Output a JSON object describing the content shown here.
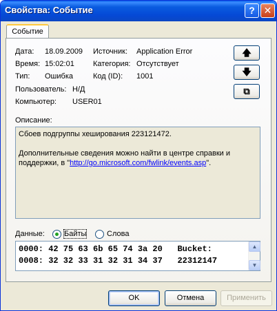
{
  "window": {
    "title": "Свойства: Событие",
    "help_glyph": "?",
    "close_glyph": "✕"
  },
  "tabs": [
    {
      "label": "Событие"
    }
  ],
  "fields": {
    "date_label": "Дата:",
    "date_value": "18.09.2009",
    "source_label": "Источник:",
    "source_value": "Application Error",
    "time_label": "Время:",
    "time_value": "15:02:01",
    "category_label": "Категория:",
    "category_value": "Отсутствует",
    "type_label": "Тип:",
    "type_value": "Ошибка",
    "eventid_label": "Код (ID):",
    "eventid_value": "1001",
    "user_label": "Пользователь:",
    "user_value": "Н/Д",
    "computer_label": "Компьютер:",
    "computer_value": "USER01"
  },
  "side_buttons": {
    "up_glyph": "🡅",
    "down_glyph": "🡇",
    "copy_glyph": "⧉"
  },
  "description": {
    "label": "Описание:",
    "line1": "Сбоев подгруппы хеширования 223121472.",
    "line2_pre": "Дополнительные сведения можно найти в центре справки и поддержки, в \"",
    "link": "http://go.microsoft.com/fwlink/events.asp",
    "line2_post": "\"."
  },
  "data_section": {
    "label": "Данные:",
    "bytes_label": "Байты",
    "words_label": "Слова",
    "selected": "bytes",
    "rows": [
      "0000: 42 75 63 6b 65 74 3a 20   Bucket: ",
      "0008: 32 32 33 31 32 31 34 37   22312147"
    ]
  },
  "footer": {
    "ok_label": "OK",
    "cancel_label": "Отмена",
    "apply_label": "Применить"
  }
}
